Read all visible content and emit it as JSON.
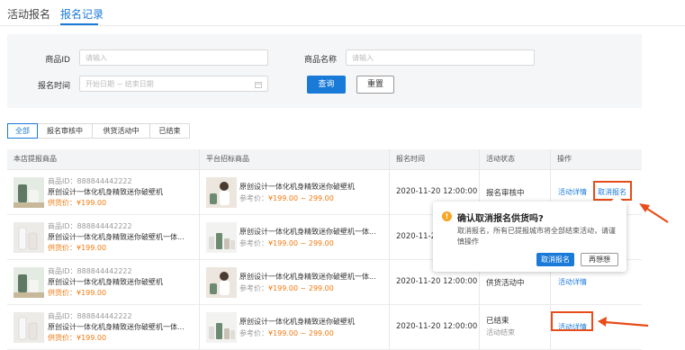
{
  "tabs": [
    {
      "label": "活动报名",
      "active": false
    },
    {
      "label": "报名记录",
      "active": true
    }
  ],
  "filter": {
    "product_id_label": "商品ID",
    "product_id_placeholder": "请输入",
    "product_name_label": "商品名称",
    "product_name_placeholder": "请输入",
    "time_label": "报名时间",
    "time_placeholder": "开始日期 ~ 结束日期",
    "query_label": "查询",
    "reset_label": "重置"
  },
  "status_tabs": [
    {
      "label": "全部",
      "active": true
    },
    {
      "label": "报名审核中",
      "active": false
    },
    {
      "label": "供货活动中",
      "active": false
    },
    {
      "label": "已结束",
      "active": false
    }
  ],
  "table": {
    "headers": [
      "本店提报商品",
      "平台招标商品",
      "报名时间",
      "活动状态",
      "操作"
    ],
    "rows": [
      {
        "own_id": "商品ID：888844442222",
        "own_name": "原创设计一体化机身精致迷你破壁机",
        "own_price": "供货价：¥199.00",
        "plat_name": "原创设计一体化机身精致迷你破壁机",
        "plat_ref_label": "参考价：",
        "plat_ref_price": "¥199.00 ~ 299.00",
        "time": "2020-11-20 12:00:00",
        "status": "报名审核中",
        "status_sub": "",
        "actions": [
          "活动详情",
          "取消报名"
        ]
      },
      {
        "own_id": "商品ID：888844442222",
        "own_name": "原创设计一体化机身精致迷你破壁机一体...",
        "own_price": "供货价：¥199.00",
        "plat_name": "原创设计一体化机身精致迷你破壁机一体...",
        "plat_ref_label": "参考价：",
        "plat_ref_price": "¥199.00 ~ 299.00",
        "time": "2020-11-20 12:00:00",
        "status": "",
        "status_sub": "",
        "actions": []
      },
      {
        "own_id": "商品ID：888844442222",
        "own_name": "原创设计一体化机身精致迷你破壁机",
        "own_price": "供货价：¥199.00",
        "plat_name": "原创设计一体化机身精致迷你破壁机一体...",
        "plat_ref_label": "参考价：",
        "plat_ref_price": "¥199.00 ~ 299.00",
        "time": "2020-11-20 12:00:00",
        "status": "供货活动中",
        "status_sub": "",
        "actions": [
          "活动详情"
        ]
      },
      {
        "own_id": "商品ID：888844442222",
        "own_name": "原创设计一体化机身精致迷你破壁机一体...",
        "own_price": "供货价：¥199.00",
        "plat_name": "原创设计一体化机身精致迷你破壁机",
        "plat_ref_label": "参考价：",
        "plat_ref_price": "¥199.00 ~ 299.00",
        "time": "2020-11-20 12:00:00",
        "status": "已结束",
        "status_sub": "活动结束",
        "actions": [
          "活动详情"
        ]
      }
    ]
  },
  "popover": {
    "icon": "warning-icon",
    "title": "确认取消报名供货吗?",
    "desc": "取消报名，所有已提报城市将全部结束活动，请谨慎操作",
    "confirm_label": "取消报名",
    "cancel_label": "再想想"
  },
  "colors": {
    "accent": "#1a7ad8",
    "price": "#f07a10",
    "highlight": "#e84c1a",
    "warning": "#f5a623"
  }
}
